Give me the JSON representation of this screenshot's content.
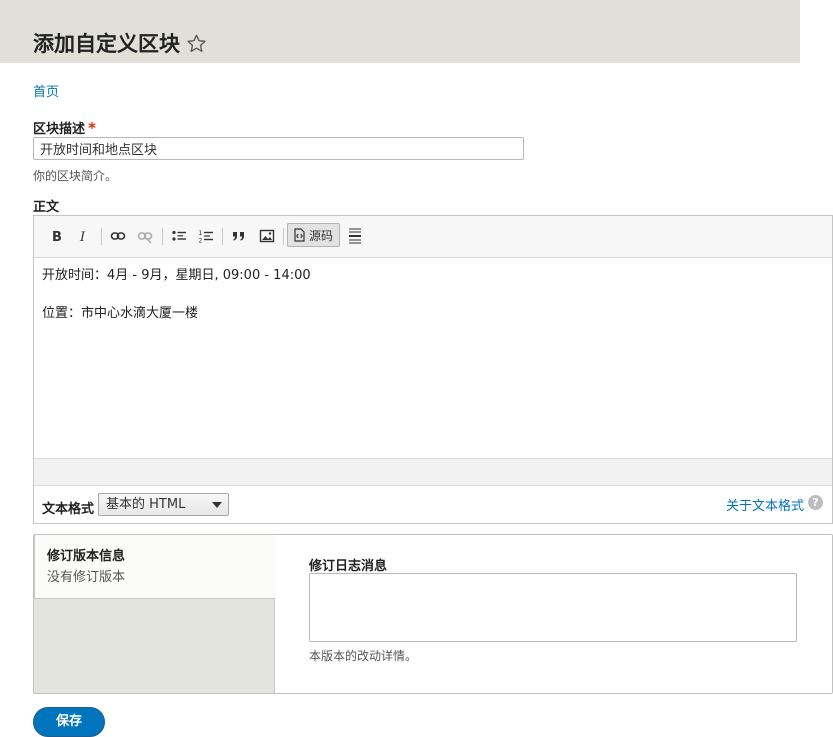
{
  "page": {
    "title": "添加自定义区块"
  },
  "breadcrumb": {
    "home": "首页"
  },
  "block_description": {
    "label": "区块描述",
    "required_marker": "*",
    "value": "开放时间和地点区块",
    "help": "你的区块简介。"
  },
  "body_field": {
    "label": "正文",
    "toolbar": {
      "source_label": "源码",
      "icons": [
        "bold-icon",
        "italic-icon",
        "link-icon",
        "unlink-icon",
        "bulleted-list-icon",
        "numbered-list-icon",
        "blockquote-icon",
        "image-icon",
        "source-icon",
        "horizontal-line-icon"
      ]
    },
    "content": [
      "开放时间：4月 - 9月，星期日, 09:00 - 14:00",
      "位置：市中心水滴大厦一楼"
    ],
    "text_format": {
      "label": "文本格式",
      "selected": "基本的 HTML",
      "help_link": "关于文本格式",
      "help_icon_glyph": "?"
    }
  },
  "revision": {
    "tab_title": "修订版本信息",
    "tab_summary": "没有修订版本",
    "log_label": "修订日志消息",
    "log_value": "",
    "log_help": "本版本的改动详情。"
  },
  "actions": {
    "save_label": "保存"
  },
  "colors": {
    "link": "#0074bd",
    "required": "#e62600",
    "header_band": "#e0e0d8",
    "primary_button": "#0074bd"
  }
}
